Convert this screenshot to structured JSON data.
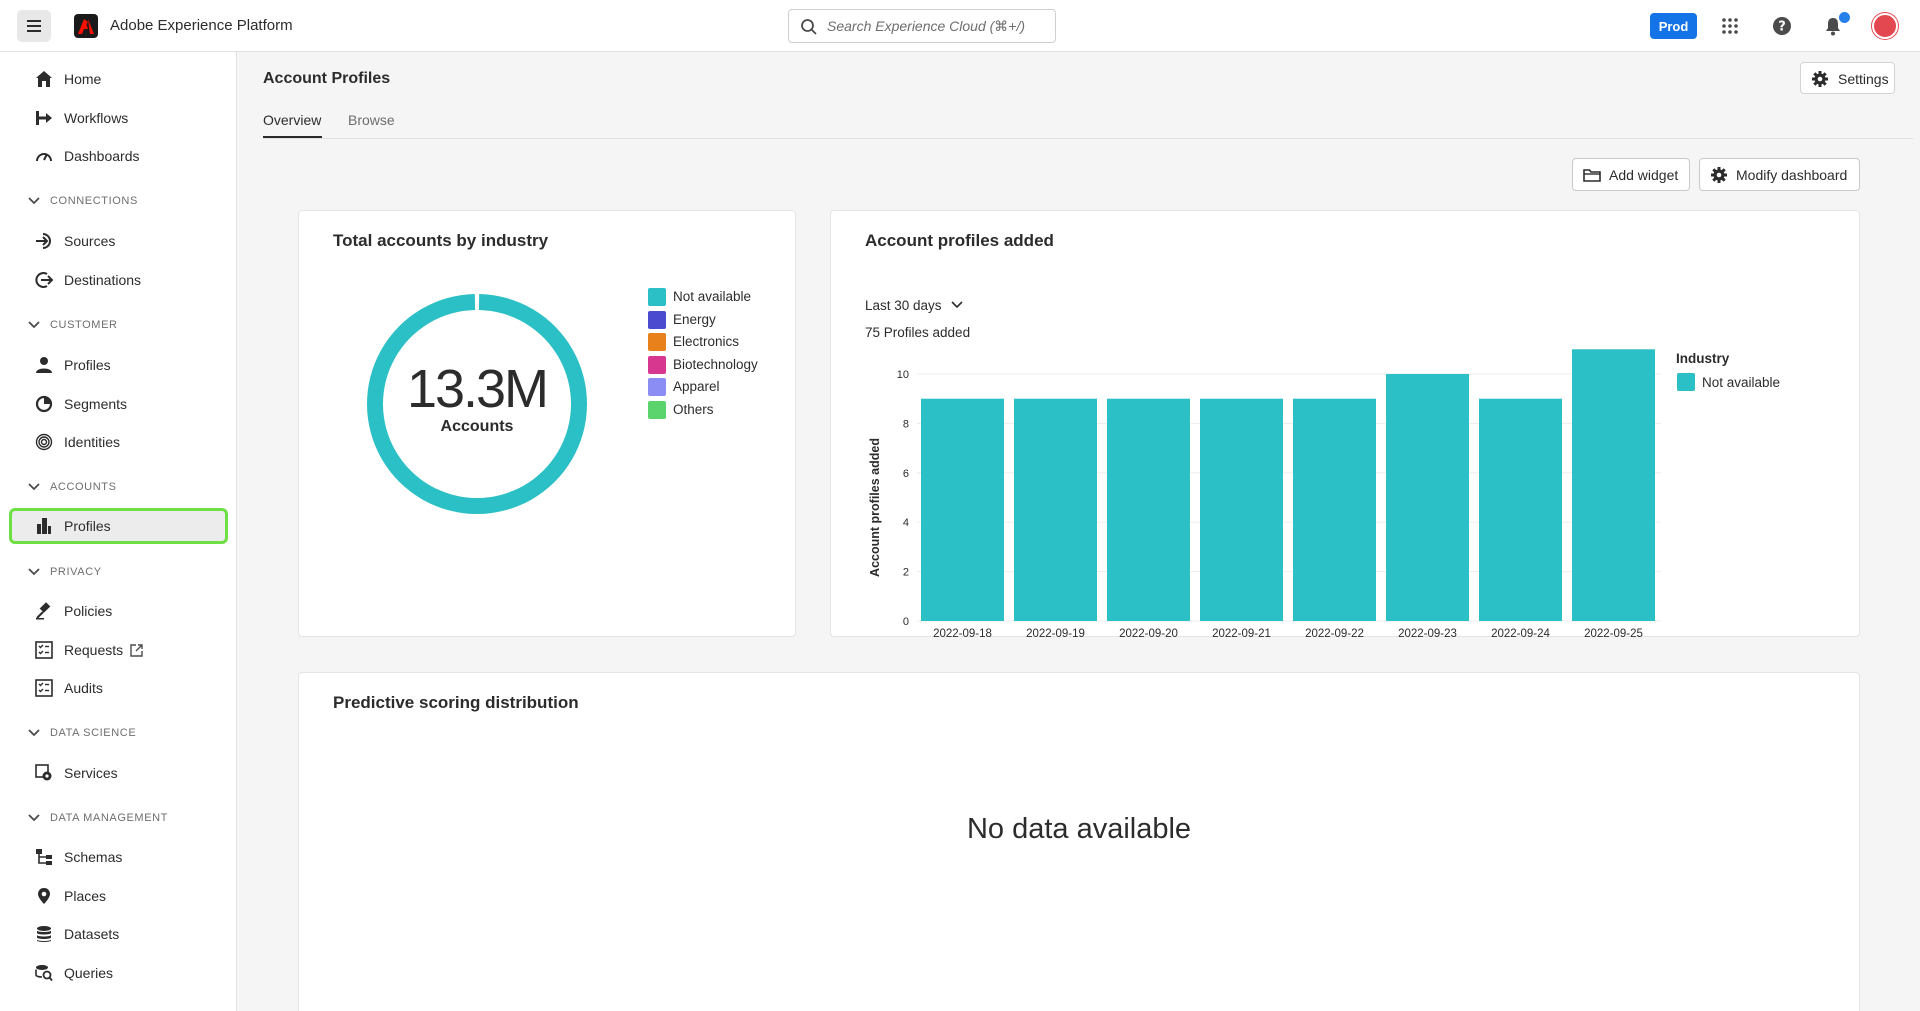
{
  "app": {
    "title": "Adobe Experience Platform",
    "search_placeholder": "Search Experience Cloud (⌘+/)",
    "env_label": "Prod"
  },
  "sidebar": {
    "items": [
      {
        "type": "item",
        "label": "Home",
        "icon": "home-icon"
      },
      {
        "type": "item",
        "label": "Workflows",
        "icon": "workflows-icon"
      },
      {
        "type": "item",
        "label": "Dashboards",
        "icon": "dashboard-icon"
      },
      {
        "type": "section",
        "label": "CONNECTIONS"
      },
      {
        "type": "item",
        "label": "Sources",
        "icon": "sources-icon"
      },
      {
        "type": "item",
        "label": "Destinations",
        "icon": "destinations-icon"
      },
      {
        "type": "section",
        "label": "CUSTOMER"
      },
      {
        "type": "item",
        "label": "Profiles",
        "icon": "person-icon"
      },
      {
        "type": "item",
        "label": "Segments",
        "icon": "segments-icon"
      },
      {
        "type": "item",
        "label": "Identities",
        "icon": "fingerprint-icon"
      },
      {
        "type": "section",
        "label": "ACCOUNTS"
      },
      {
        "type": "item",
        "label": "Profiles",
        "icon": "building-icon",
        "active": true
      },
      {
        "type": "section",
        "label": "PRIVACY"
      },
      {
        "type": "item",
        "label": "Policies",
        "icon": "gavel-icon"
      },
      {
        "type": "item",
        "label": "Requests",
        "icon": "checklist-icon",
        "external": true
      },
      {
        "type": "item",
        "label": "Audits",
        "icon": "checklist-icon"
      },
      {
        "type": "section",
        "label": "DATA SCIENCE"
      },
      {
        "type": "item",
        "label": "Services",
        "icon": "services-icon"
      },
      {
        "type": "section",
        "label": "DATA MANAGEMENT"
      },
      {
        "type": "item",
        "label": "Schemas",
        "icon": "schema-icon"
      },
      {
        "type": "item",
        "label": "Places",
        "icon": "pin-icon"
      },
      {
        "type": "item",
        "label": "Datasets",
        "icon": "database-icon"
      },
      {
        "type": "item",
        "label": "Queries",
        "icon": "query-icon"
      }
    ]
  },
  "page": {
    "title": "Account Profiles",
    "settings_label": "Settings",
    "tabs": [
      {
        "label": "Overview",
        "active": true
      },
      {
        "label": "Browse",
        "active": false
      }
    ],
    "add_widget_label": "Add widget",
    "modify_dashboard_label": "Modify dashboard"
  },
  "widgets": {
    "industry": {
      "title": "Total accounts by industry",
      "total_value": "13.3M",
      "total_label": "Accounts"
    },
    "added": {
      "title": "Account profiles added",
      "range_label": "Last 30 days",
      "summary": "75 Profiles added"
    },
    "predictive": {
      "title": "Predictive scoring distribution",
      "empty_text": "No data available"
    }
  },
  "chart_data": [
    {
      "type": "pie",
      "categories": [
        "Not available",
        "Energy",
        "Electronics",
        "Biotechnology",
        "Apparel",
        "Others"
      ],
      "values": [
        100,
        0,
        0,
        0,
        0,
        0
      ],
      "colors": [
        "#2bbfc6",
        "#4b4bcf",
        "#e8801b",
        "#d83790",
        "#8c8cf5",
        "#5bd46e"
      ],
      "legend": "right"
    },
    {
      "type": "bar",
      "categories": [
        "2022-09-18",
        "2022-09-19",
        "2022-09-20",
        "2022-09-21",
        "2022-09-22",
        "2022-09-23",
        "2022-09-24",
        "2022-09-25"
      ],
      "series": [
        {
          "name": "Not available",
          "values": [
            9,
            9,
            9,
            9,
            9,
            10,
            9,
            11
          ],
          "color": "#2bbfc6"
        }
      ],
      "ylabel": "Account profiles added",
      "yticks": [
        "0",
        "2",
        "4",
        "6",
        "8",
        "10"
      ],
      "ylim": [
        0,
        10
      ],
      "legend_title": "Industry",
      "legend": "right",
      "grid": true
    }
  ]
}
